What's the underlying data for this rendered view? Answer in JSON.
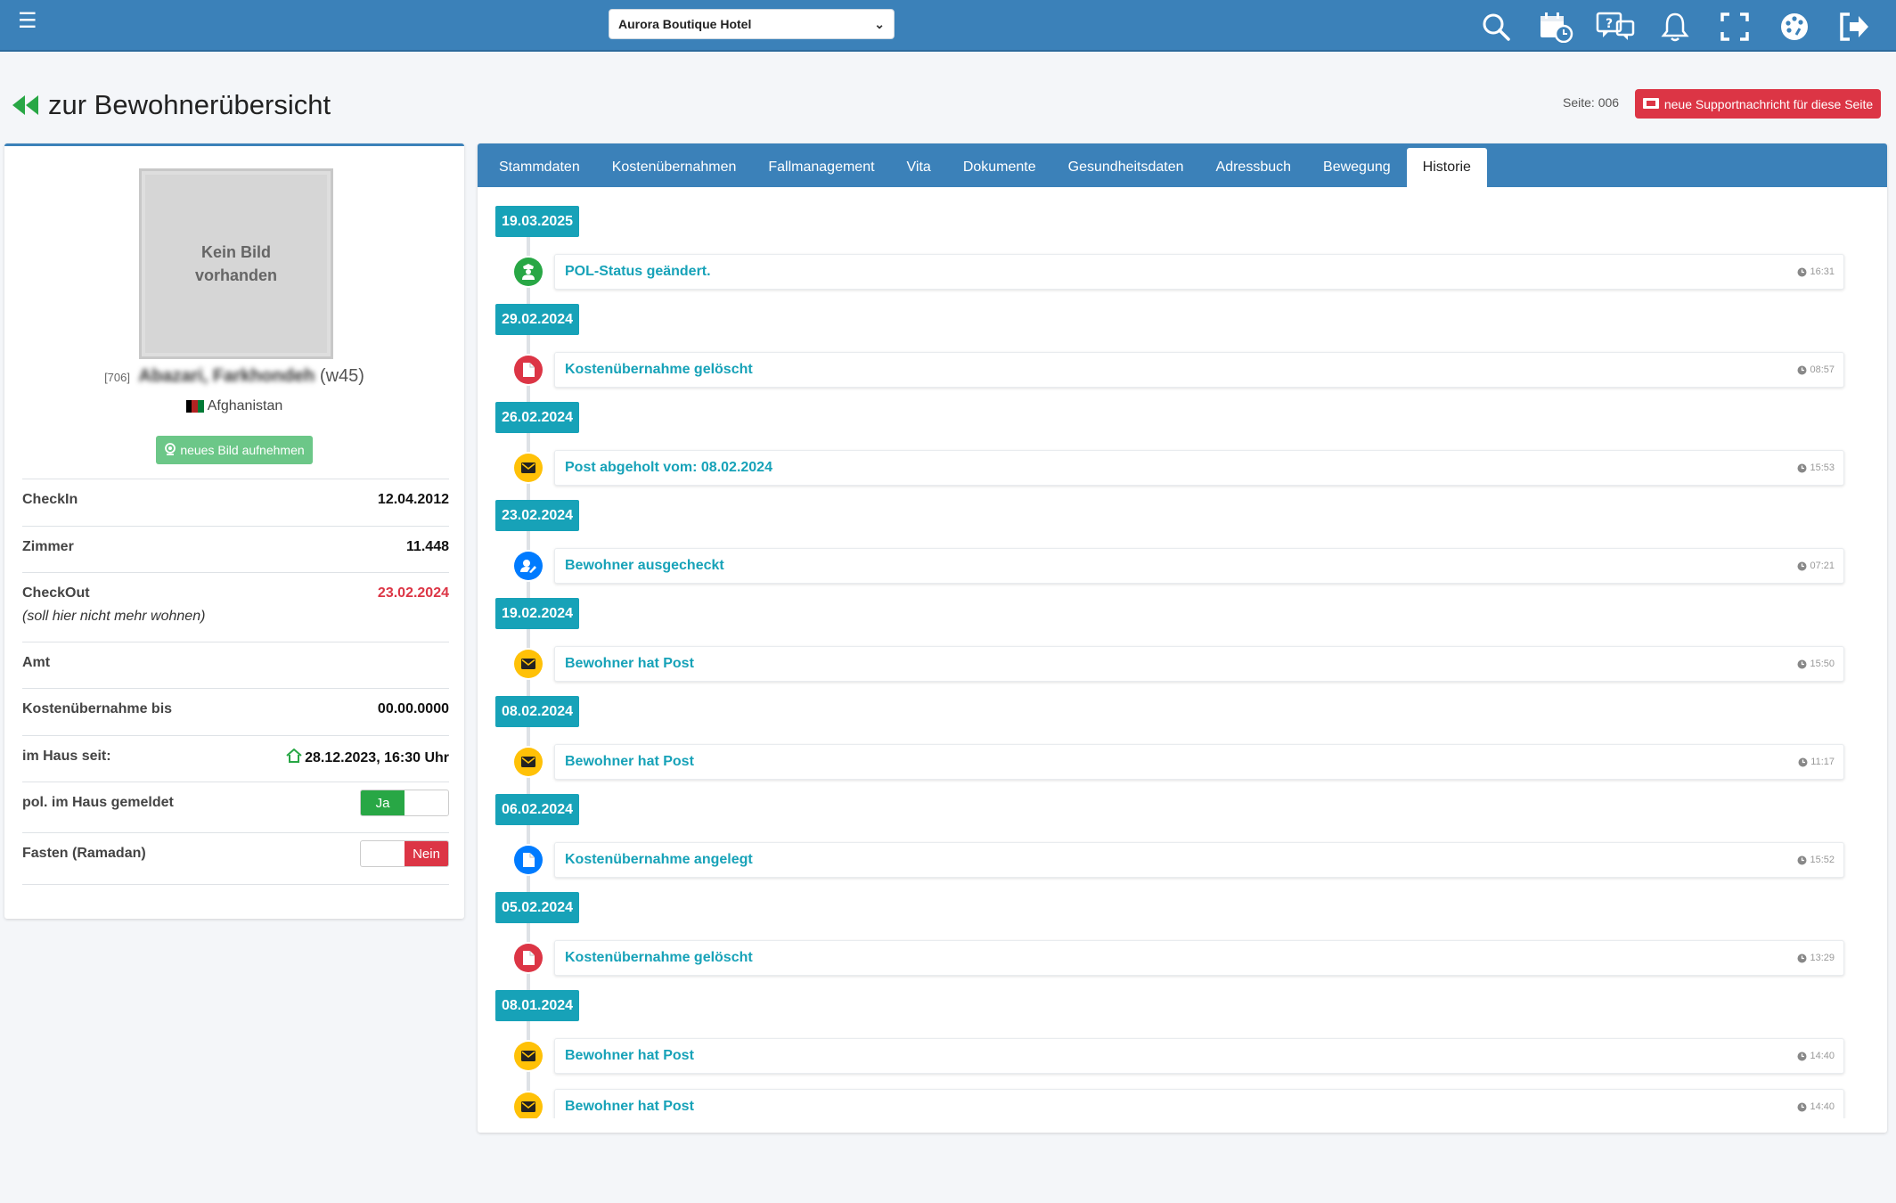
{
  "header": {
    "hotel": "Aurora Boutique Hotel",
    "icons": [
      "search-icon",
      "calendar-clock-icon",
      "support-chat-icon",
      "bell-icon",
      "fullscreen-icon",
      "palette-icon",
      "logout-icon"
    ]
  },
  "page": {
    "back_label": "zur Bewohnerübersicht",
    "page_number": "Seite: 006",
    "support_button": "neue Supportnachricht für diese Seite"
  },
  "resident": {
    "photo_placeholder": "Kein Bild\nvorhanden",
    "id": "[706]",
    "name": "Abazari, Farkhondeh",
    "week": "(w45)",
    "country": "Afghanistan",
    "photo_button": "neues Bild aufnehmen",
    "fields": {
      "checkin_label": "CheckIn",
      "checkin_value": "12.04.2012",
      "zimmer_label": "Zimmer",
      "zimmer_value": "11.448",
      "checkout_label": "CheckOut",
      "checkout_value": "23.02.2024",
      "checkout_note": "(soll hier nicht mehr wohnen)",
      "amt_label": "Amt",
      "kosten_label": "Kostenübernahme bis",
      "kosten_value": "00.00.0000",
      "haus_label": "im Haus seit:",
      "haus_value": "28.12.2023, 16:30 Uhr",
      "pol_label": "pol. im Haus gemeldet",
      "pol_value": "Ja",
      "fasten_label": "Fasten (Ramadan)",
      "fasten_value": "Nein"
    }
  },
  "tabs": [
    "Stammdaten",
    "Kostenübernahmen",
    "Fallmanagement",
    "Vita",
    "Dokumente",
    "Gesundheitsdaten",
    "Adressbuch",
    "Bewegung",
    "Historie"
  ],
  "active_tab": "Historie",
  "timeline": [
    {
      "date": "19.03.2025",
      "items": [
        {
          "text": "POL-Status geändert.",
          "time": "16:31",
          "icon": "police-icon",
          "color": "#28a745"
        }
      ]
    },
    {
      "date": "29.02.2024",
      "items": [
        {
          "text": "Kostenübernahme gelöscht",
          "time": "08:57",
          "icon": "document-icon",
          "color": "#dc3545"
        }
      ]
    },
    {
      "date": "26.02.2024",
      "items": [
        {
          "text": "Post abgeholt vom: 08.02.2024",
          "time": "15:53",
          "icon": "envelope-icon",
          "color": "#ffc107"
        }
      ]
    },
    {
      "date": "23.02.2024",
      "items": [
        {
          "text": "Bewohner ausgecheckt",
          "time": "07:21",
          "icon": "user-edit-icon",
          "color": "#007bff"
        }
      ]
    },
    {
      "date": "19.02.2024",
      "items": [
        {
          "text": "Bewohner hat Post",
          "time": "15:50",
          "icon": "envelope-icon",
          "color": "#ffc107"
        }
      ]
    },
    {
      "date": "08.02.2024",
      "items": [
        {
          "text": "Bewohner hat Post",
          "time": "11:17",
          "icon": "envelope-icon",
          "color": "#ffc107"
        }
      ]
    },
    {
      "date": "06.02.2024",
      "items": [
        {
          "text": "Kostenübernahme angelegt",
          "time": "15:52",
          "icon": "document-icon",
          "color": "#007bff"
        }
      ]
    },
    {
      "date": "05.02.2024",
      "items": [
        {
          "text": "Kostenübernahme gelöscht",
          "time": "13:29",
          "icon": "document-icon",
          "color": "#dc3545"
        }
      ]
    },
    {
      "date": "08.01.2024",
      "items": [
        {
          "text": "Bewohner hat Post",
          "time": "14:40",
          "icon": "envelope-icon",
          "color": "#ffc107"
        },
        {
          "text": "Bewohner hat Post",
          "time": "14:40",
          "icon": "envelope-icon",
          "color": "#ffc107"
        }
      ]
    }
  ]
}
